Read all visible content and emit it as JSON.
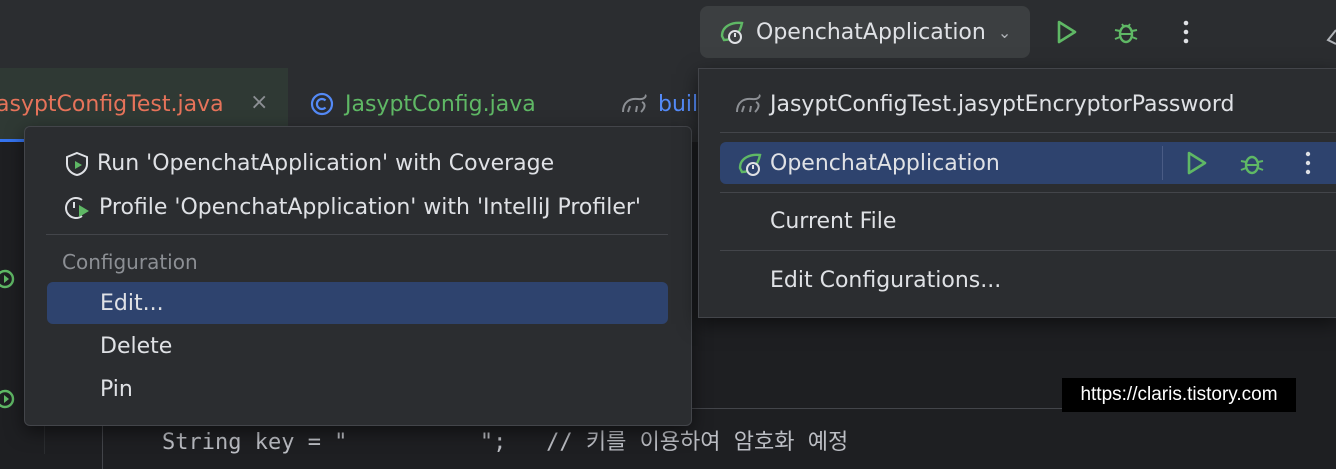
{
  "toolbar": {
    "run_config_label": "OpenchatApplication",
    "run_icon": "run-icon",
    "debug_icon": "debug-icon",
    "more_icon": "more-vertical-icon",
    "colors": {
      "run": "#5fb865",
      "selection": "#2e436e"
    }
  },
  "tabs": [
    {
      "label": "asyptConfigTest.java",
      "close": "×"
    },
    {
      "label": "JasyptConfig.java"
    },
    {
      "label": "buil"
    }
  ],
  "left_popup": {
    "items": [
      {
        "label": "Run 'OpenchatApplication' with Coverage"
      },
      {
        "label": "Profile 'OpenchatApplication' with 'IntelliJ Profiler'"
      }
    ],
    "section_header": "Configuration",
    "config_items": [
      {
        "label": "Edit..."
      },
      {
        "label": "Delete"
      },
      {
        "label": "Pin"
      }
    ]
  },
  "right_popup": {
    "items": [
      {
        "label": "JasyptConfigTest.jasyptEncryptorPassword"
      },
      {
        "label": "OpenchatApplication"
      },
      {
        "label": "Current File"
      },
      {
        "label": "Edit Configurations..."
      }
    ]
  },
  "editor": {
    "code_line": "String key = \"          \";   // 키를 이용하여 암호화 예정"
  },
  "watermark": "https://claris.tistory.com"
}
